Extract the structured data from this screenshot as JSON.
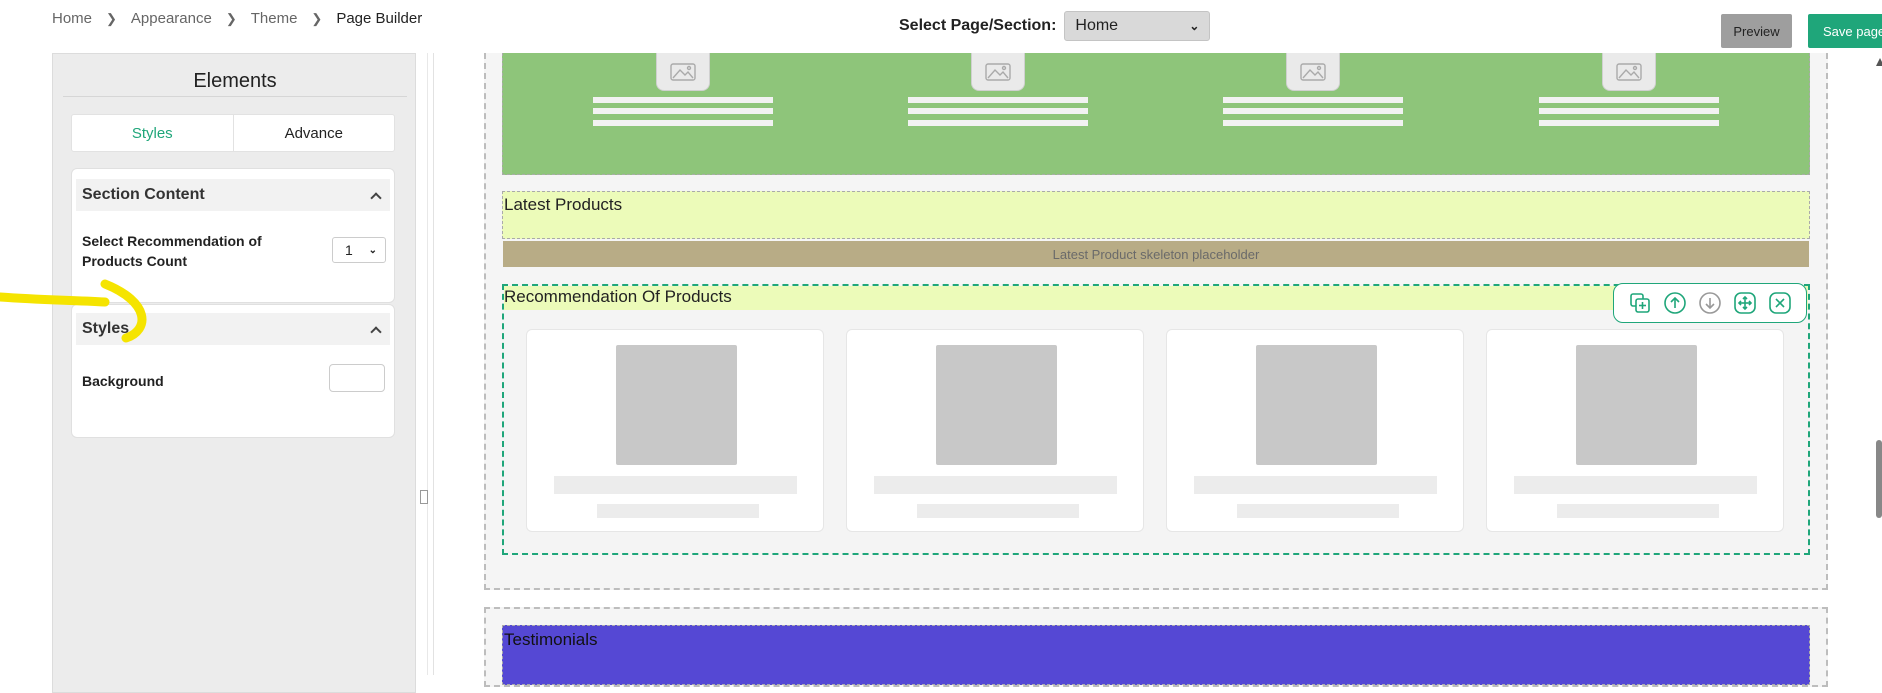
{
  "breadcrumb": {
    "items": [
      "Home",
      "Appearance",
      "Theme"
    ],
    "current": "Page Builder"
  },
  "header": {
    "select_label": "Select Page/Section:",
    "select_value": "Home",
    "preview_label": "Preview",
    "save_label": "Save page"
  },
  "panel": {
    "title": "Elements",
    "tabs": [
      "Styles",
      "Advance"
    ],
    "active_tab": "Styles",
    "section_content": {
      "heading": "Section Content",
      "field_label": "Select Recommendation of Products Count",
      "field_value": "1"
    },
    "styles": {
      "heading": "Styles",
      "background_label": "Background"
    }
  },
  "canvas": {
    "latest_title": "Latest Products",
    "latest_placeholder": "Latest Product skeleton placeholder",
    "recommendation_title": "Recommendation Of Products",
    "testimonials_title": "Testimonials",
    "toolbar_icons": [
      "duplicate-icon",
      "move-up-icon",
      "move-down-icon",
      "drag-move-icon",
      "remove-icon"
    ],
    "feature_count": 4,
    "product_count": 4
  },
  "colors": {
    "accent": "#1fa67a",
    "feature_band": "#8ec57a",
    "latest_band": "#ecfbb9",
    "testimonials_band": "#5548d4",
    "annotation": "#f5e400"
  }
}
